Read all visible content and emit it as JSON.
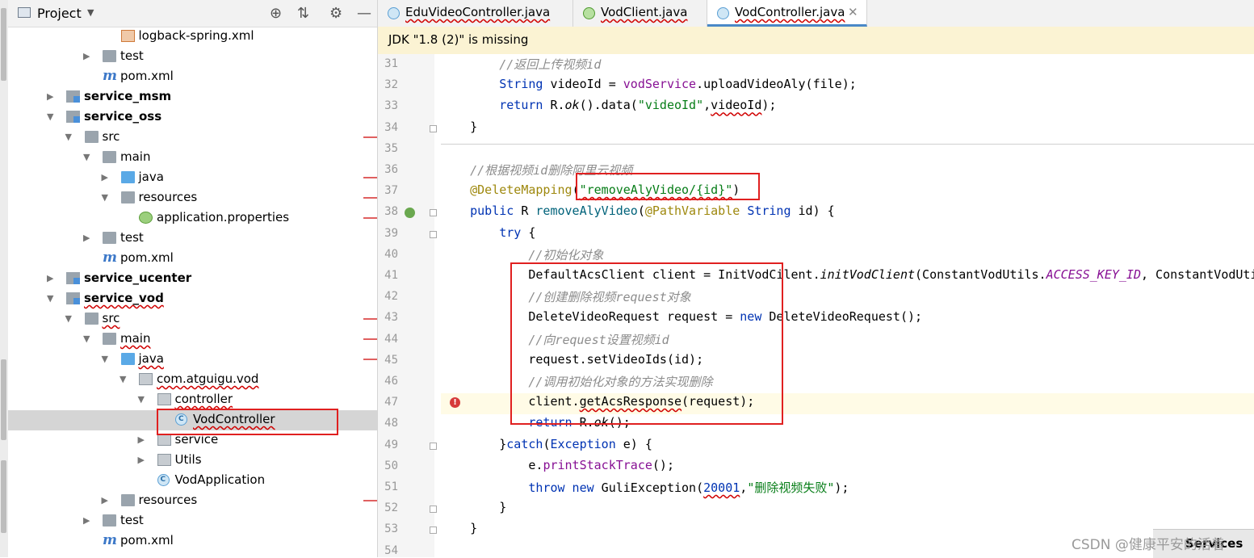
{
  "project_panel": {
    "title": "Project",
    "tree": [
      {
        "label": "logback-spring.xml",
        "kind": "xml",
        "indent": 4,
        "arrow": "none"
      },
      {
        "label": "test",
        "kind": "folder",
        "indent": 3,
        "arrow": "closed"
      },
      {
        "label": "pom.xml",
        "kind": "maven",
        "indent": 3,
        "arrow": "none"
      },
      {
        "label": "service_msm",
        "kind": "module",
        "indent": 1,
        "arrow": "closed",
        "bold": true
      },
      {
        "label": "service_oss",
        "kind": "module",
        "indent": 1,
        "arrow": "open",
        "bold": true
      },
      {
        "label": "src",
        "kind": "folder",
        "indent": 2,
        "arrow": "open"
      },
      {
        "label": "main",
        "kind": "folder",
        "indent": 3,
        "arrow": "open"
      },
      {
        "label": "java",
        "kind": "folder-blue",
        "indent": 4,
        "arrow": "closed"
      },
      {
        "label": "resources",
        "kind": "res",
        "indent": 4,
        "arrow": "open"
      },
      {
        "label": "application.properties",
        "kind": "prop",
        "indent": 5,
        "arrow": "none"
      },
      {
        "label": "test",
        "kind": "folder",
        "indent": 3,
        "arrow": "closed"
      },
      {
        "label": "pom.xml",
        "kind": "maven",
        "indent": 3,
        "arrow": "none"
      },
      {
        "label": "service_ucenter",
        "kind": "module",
        "indent": 1,
        "arrow": "closed",
        "bold": true
      },
      {
        "label": "service_vod",
        "kind": "module",
        "indent": 1,
        "arrow": "open",
        "bold": true,
        "wavy": true
      },
      {
        "label": "src",
        "kind": "folder",
        "indent": 2,
        "arrow": "open",
        "wavy": true
      },
      {
        "label": "main",
        "kind": "folder",
        "indent": 3,
        "arrow": "open",
        "wavy": true
      },
      {
        "label": "java",
        "kind": "folder-blue",
        "indent": 4,
        "arrow": "open",
        "wavy": true
      },
      {
        "label": "com.atguigu.vod",
        "kind": "package",
        "indent": 5,
        "arrow": "open",
        "wavy": true
      },
      {
        "label": "controller",
        "kind": "package",
        "indent": 6,
        "arrow": "open",
        "wavy": true
      },
      {
        "label": "VodController",
        "kind": "class",
        "indent": 7,
        "arrow": "none",
        "wavy": true,
        "selected": true
      },
      {
        "label": "service",
        "kind": "package",
        "indent": 6,
        "arrow": "closed"
      },
      {
        "label": "Utils",
        "kind": "package",
        "indent": 6,
        "arrow": "closed"
      },
      {
        "label": "VodApplication",
        "kind": "class",
        "indent": 6,
        "arrow": "none"
      },
      {
        "label": "resources",
        "kind": "res",
        "indent": 4,
        "arrow": "closed"
      },
      {
        "label": "test",
        "kind": "folder",
        "indent": 3,
        "arrow": "closed"
      },
      {
        "label": "pom.xml",
        "kind": "maven",
        "indent": 3,
        "arrow": "none"
      }
    ]
  },
  "tabs": [
    {
      "label": "EduVideoController.java",
      "icon": "class",
      "active": false
    },
    {
      "label": "VodClient.java",
      "icon": "interface",
      "active": false
    },
    {
      "label": "VodController.java",
      "icon": "class",
      "active": true
    }
  ],
  "notice": "JDK \"1.8 (2)\" is missing",
  "code_lines": [
    {
      "n": "31",
      "html": "        <span class=\"cmtc\">//返回上传视频id</span>"
    },
    {
      "n": "32",
      "html": "        <span class=\"kw\">String</span> videoId = <span class=\"fld\">vodService</span>.uploadVideoAly(file);"
    },
    {
      "n": "33",
      "html": "        <span class=\"kw\">return</span> R.<span class=\"ital\">ok</span>().data(<span class=\"str\">\"videoId\"</span>,<span class=\"err\">videoId</span>);"
    },
    {
      "n": "34",
      "html": "    }"
    },
    {
      "n": "35",
      "html": ""
    },
    {
      "n": "36",
      "html": "    <span class=\"cmtc\">//根据视频id删除阿里云视频</span>"
    },
    {
      "n": "37",
      "html": "    <span class=\"ann\">@DeleteMapping</span>(<span class=\"str err\">\"removeAlyVideo/{id}\"</span>)"
    },
    {
      "n": "38",
      "html": "    <span class=\"kw\">public</span> R <span style=\"color:#00627a\">removeAlyVideo</span>(<span class=\"ann\">@PathVariable</span> <span class=\"kw\">String</span> id) {"
    },
    {
      "n": "39",
      "html": "        <span class=\"kw\">try</span> {"
    },
    {
      "n": "40",
      "html": "            <span class=\"cmtc\">//初始化对象</span>"
    },
    {
      "n": "41",
      "html": "            DefaultAcsClient client = InitVodCilent.<span class=\"ital\">initVodClient</span>(ConstantVodUtils.<span class=\"fld ital\">ACCESS_KEY_ID</span>, ConstantVodUtils.<span class=\"fld ital\">ACCESS_KEY_SECRET</span>);"
    },
    {
      "n": "42",
      "html": "            <span class=\"cmtc\">//创建删除视频request对象</span>"
    },
    {
      "n": "43",
      "html": "            DeleteVideoRequest request = <span class=\"kw\">new</span> DeleteVideoRequest();"
    },
    {
      "n": "44",
      "html": "            <span class=\"cmtc\">//向request设置视频id</span>"
    },
    {
      "n": "45",
      "html": "            request.setVideoIds(id);"
    },
    {
      "n": "46",
      "html": "            <span class=\"cmtc\">//调用初始化对象的方法实现删除</span>"
    },
    {
      "n": "47",
      "html": "            client.<span class=\"err\">getAcsResponse</span>(request);"
    },
    {
      "n": "48",
      "html": "            <span class=\"kw\">return</span> R.<span class=\"ital\">ok</span>();"
    },
    {
      "n": "49",
      "html": "        }<span class=\"kw\">catch</span>(<span class=\"kw\">Exception</span> e) {"
    },
    {
      "n": "50",
      "html": "            e.<span class=\"fld\">printStackTrace</span>();"
    },
    {
      "n": "51",
      "html": "            <span class=\"kw\">throw new</span> GuliException(<span class=\"kw err\">20001</span>,<span class=\"str\">\"删除视频失败\"</span>);"
    },
    {
      "n": "52",
      "html": "        }"
    },
    {
      "n": "53",
      "html": "    }"
    },
    {
      "n": "54",
      "html": ""
    }
  ],
  "services_label": "Services",
  "watermark": "CSDN @健康平安的活着"
}
